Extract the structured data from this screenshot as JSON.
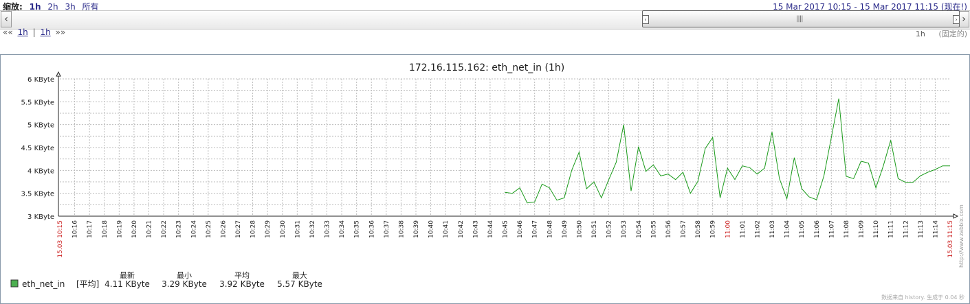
{
  "toolbar": {
    "zoom_label": "缩放:",
    "zoom_options": [
      "1h",
      "2h",
      "3h",
      "所有"
    ],
    "active_zoom": "1h",
    "period_text": "15 Mar 2017 10:15  -  15 Mar 2017 11:15 (现在!)",
    "nav_back_symbol": "««",
    "nav_back_step": "1h",
    "nav_separator": "|",
    "nav_fwd_step": "1h",
    "nav_fwd_symbol": "»»",
    "period_length": "1h",
    "fixed_label": "(固定的)",
    "left_arrow": "‹",
    "right_arrow": "›"
  },
  "chart_data": {
    "type": "line",
    "title": "172.16.115.162: eth_net_in (1h)",
    "y_unit": "KByte",
    "yticks": [
      "3 KByte",
      "3.5 KByte",
      "4 KByte",
      "4.5 KByte",
      "5 KByte",
      "5.5 KByte",
      "6 KByte"
    ],
    "ylim": [
      3,
      6
    ],
    "x_start_label": "15.03 10:15",
    "x_end_label": "15.03 11:15",
    "xticks": [
      "10:16",
      "10:17",
      "10:18",
      "10:19",
      "10:20",
      "10:21",
      "10:22",
      "10:23",
      "10:24",
      "10:25",
      "10:26",
      "10:27",
      "10:28",
      "10:29",
      "10:30",
      "10:31",
      "10:32",
      "10:33",
      "10:34",
      "10:35",
      "10:36",
      "10:37",
      "10:38",
      "10:39",
      "10:40",
      "10:41",
      "10:42",
      "10:43",
      "10:44",
      "10:45",
      "10:46",
      "10:47",
      "10:48",
      "10:49",
      "10:50",
      "10:51",
      "10:52",
      "10:53",
      "10:54",
      "10:55",
      "10:56",
      "10:57",
      "10:58",
      "10:59",
      "11:00",
      "11:01",
      "11:02",
      "11:03",
      "11:04",
      "11:05",
      "11:06",
      "11:07",
      "11:08",
      "11:09",
      "11:10",
      "11:11",
      "11:12",
      "11:13",
      "11:14"
    ],
    "highlight_ticks": [
      "11:00"
    ],
    "grid": true,
    "series": [
      {
        "name": "eth_net_in",
        "color": "#1a9a1a",
        "x_minutes": [
          30.0,
          30.5,
          31.0,
          31.5,
          32.0,
          32.5,
          33.0,
          33.5,
          34.0,
          34.5,
          35.0,
          35.5,
          36.0,
          36.5,
          37.0,
          37.5,
          38.0,
          38.5,
          39.0,
          39.5,
          40.0,
          40.5,
          41.0,
          41.5,
          42.0,
          42.5,
          43.0,
          43.5,
          44.0,
          44.5,
          45.0,
          45.5,
          46.0,
          46.5,
          47.0,
          47.5,
          48.0,
          48.5,
          49.0,
          49.5,
          50.0,
          50.5,
          51.0,
          51.5,
          52.0,
          52.5,
          53.0,
          53.5,
          54.0,
          54.5,
          55.0,
          55.5,
          56.0,
          56.5,
          57.0,
          57.5,
          58.0,
          58.5,
          59.0,
          59.5,
          60.0
        ],
        "values": [
          3.52,
          3.5,
          3.62,
          3.29,
          3.31,
          3.7,
          3.62,
          3.35,
          3.4,
          4.0,
          4.4,
          3.6,
          3.75,
          3.4,
          3.8,
          4.18,
          5.0,
          3.55,
          4.52,
          3.98,
          4.12,
          3.88,
          3.92,
          3.8,
          3.96,
          3.5,
          3.76,
          4.48,
          4.72,
          3.4,
          4.05,
          3.8,
          4.1,
          4.06,
          3.92,
          4.05,
          4.84,
          3.82,
          3.38,
          4.28,
          3.6,
          3.42,
          3.36,
          3.88,
          4.72,
          5.57,
          3.87,
          3.82,
          4.2,
          4.16,
          3.62,
          4.1,
          4.66,
          3.82,
          3.74,
          3.74,
          3.88,
          3.96,
          4.02,
          4.1,
          4.1
        ]
      }
    ],
    "legend": {
      "series_name": "eth_net_in",
      "series_color": "#4caf50",
      "func": "[平均]",
      "headers": [
        "最新",
        "最小",
        "平均",
        "最大"
      ],
      "values": [
        "4.11 KByte",
        "3.29 KByte",
        "3.92 KByte",
        "5.57 KByte"
      ]
    },
    "side_text": "http://www.zabbix.com",
    "footer_text": "数据来自 history. 生成于 0.04 秒"
  }
}
